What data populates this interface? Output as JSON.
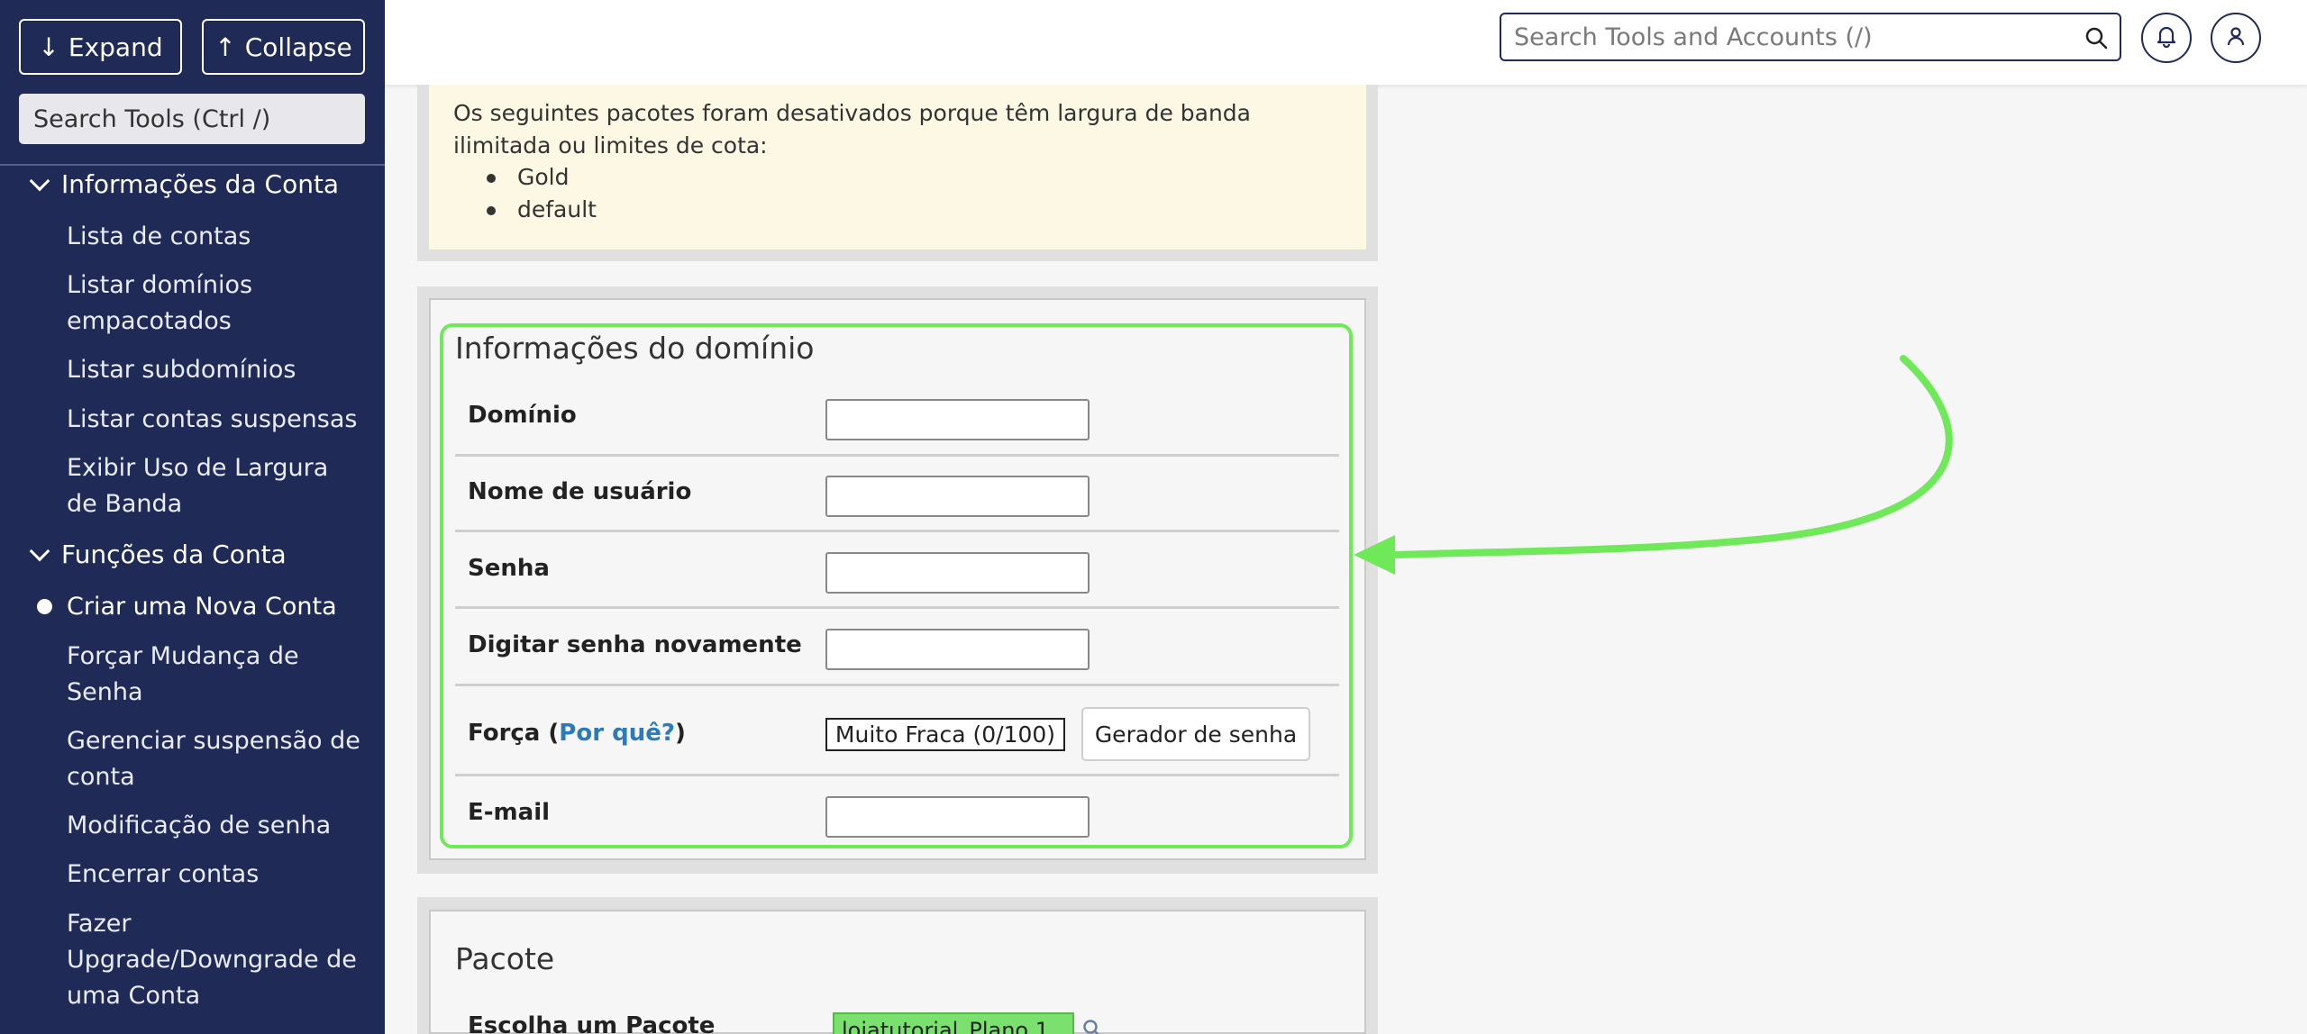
{
  "sidebar": {
    "expand_label": "Expand",
    "collapse_label": "Collapse",
    "search_placeholder": "Search Tools (Ctrl /)",
    "sections": [
      {
        "label": "Informações da Conta",
        "items": [
          "Lista de contas",
          "Listar domínios empacotados",
          "Listar subdomínios",
          "Listar contas suspensas",
          "Exibir Uso de Largura de Banda"
        ]
      },
      {
        "label": "Funções da Conta",
        "items": [
          "Criar uma Nova Conta",
          "Forçar Mudança de Senha",
          "Gerenciar suspensão de conta",
          "Modificação de senha",
          "Encerrar contas",
          "Fazer Upgrade/Downgrade de uma Conta"
        ]
      }
    ],
    "active_item": "Criar uma Nova Conta"
  },
  "header": {
    "search_placeholder": "Search Tools and Accounts (/)",
    "icons": [
      "search-icon",
      "bell-icon",
      "user-icon"
    ]
  },
  "notice": {
    "text": "Os seguintes pacotes foram desativados porque têm largura de banda ilimitada ou limites de cota:",
    "packages": [
      "Gold",
      "default"
    ]
  },
  "domain_info": {
    "title": "Informações do domínio",
    "fields": {
      "domain": "Domínio",
      "username": "Nome de usuário",
      "password": "Senha",
      "password_again": "Digitar senha novamente",
      "strength_prefix": "Força (",
      "strength_link": "Por quê?",
      "strength_suffix": ")",
      "email": "E-mail"
    },
    "strength_value": "Muito Fraca (0/100)",
    "generator_label": "Gerador de senha"
  },
  "package": {
    "title": "Pacote",
    "choose_label": "Escolha um Pacote",
    "selected": "lojatutorial_Plano 1"
  },
  "colors": {
    "sidebar_bg": "#1f2a56",
    "highlight": "#6fe85a",
    "notice_bg": "#fcf8e3",
    "link": "#2a7bbd"
  }
}
